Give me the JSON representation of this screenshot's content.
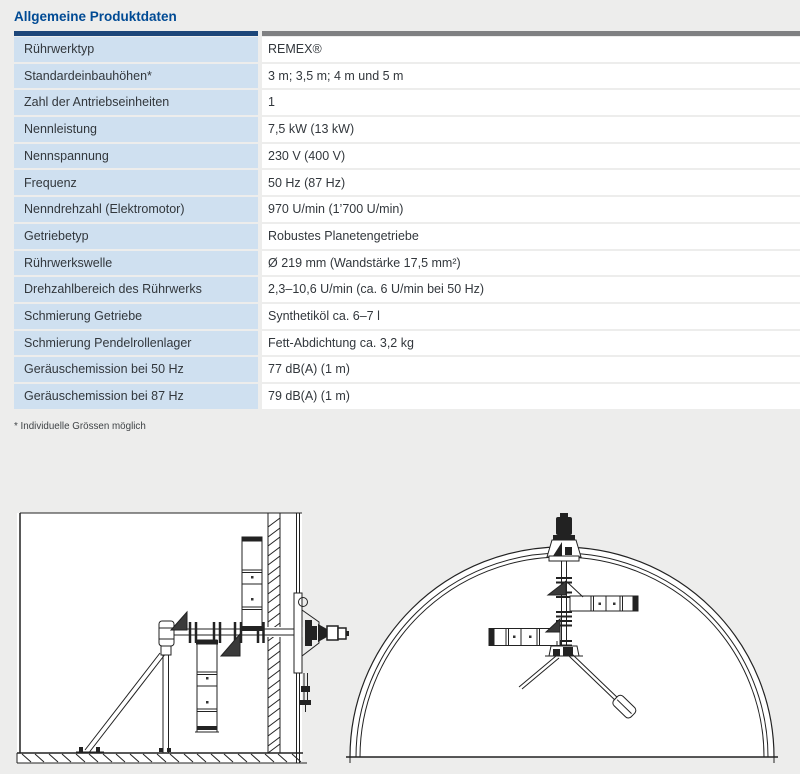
{
  "page": {
    "title": "Allgemeine Produktdaten",
    "footnote": "* Individuelle Grössen möglich"
  },
  "table": {
    "rows": [
      {
        "label": "Rührwerktyp",
        "value": "REMEX®"
      },
      {
        "label": "Standardeinbauhöhen*",
        "value": "3 m; 3,5 m; 4 m und 5 m"
      },
      {
        "label": "Zahl der Antriebseinheiten",
        "value": "1"
      },
      {
        "label": "Nennleistung",
        "value": "7,5 kW (13 kW)"
      },
      {
        "label": "Nennspannung",
        "value": "230 V (400 V)"
      },
      {
        "label": "Frequenz",
        "value": "50 Hz (87 Hz)"
      },
      {
        "label": "Nenndrehzahl (Elektromotor)",
        "value": "970 U/min (1’700 U/min)"
      },
      {
        "label": "Getriebetyp",
        "value": "Robustes Planetengetriebe"
      },
      {
        "label": "Rührwerkswelle",
        "value": "Ø 219 mm (Wandstärke 17,5 mm²)"
      },
      {
        "label": "Drehzahlbereich des Rührwerks",
        "value": "2,3–10,6 U/min (ca. 6 U/min bei 50 Hz)"
      },
      {
        "label": "Schmierung Getriebe",
        "value": "Synthetiköl ca. 6–7 l"
      },
      {
        "label": "Schmierung Pendelrollenlager",
        "value": "Fett-Abdichtung ca. 3,2 kg"
      },
      {
        "label": "Geräuschemission bei 50 Hz",
        "value": "77 dB(A) (1 m)"
      },
      {
        "label": "Geräuschemission bei 87 Hz",
        "value": "79 dB(A) (1 m)"
      }
    ]
  },
  "figures": [
    {
      "name": "wall-mounted-agitator-side-view-drawing"
    },
    {
      "name": "dome-tank-agitator-cross-section-drawing"
    }
  ],
  "colors": {
    "page_bg": "#ededec",
    "title": "#004a94",
    "header_bar_left": "#1c4679",
    "header_bar_right": "#7f8082",
    "label_cell_bg": "#cfe0f0",
    "text": "#32373c"
  }
}
